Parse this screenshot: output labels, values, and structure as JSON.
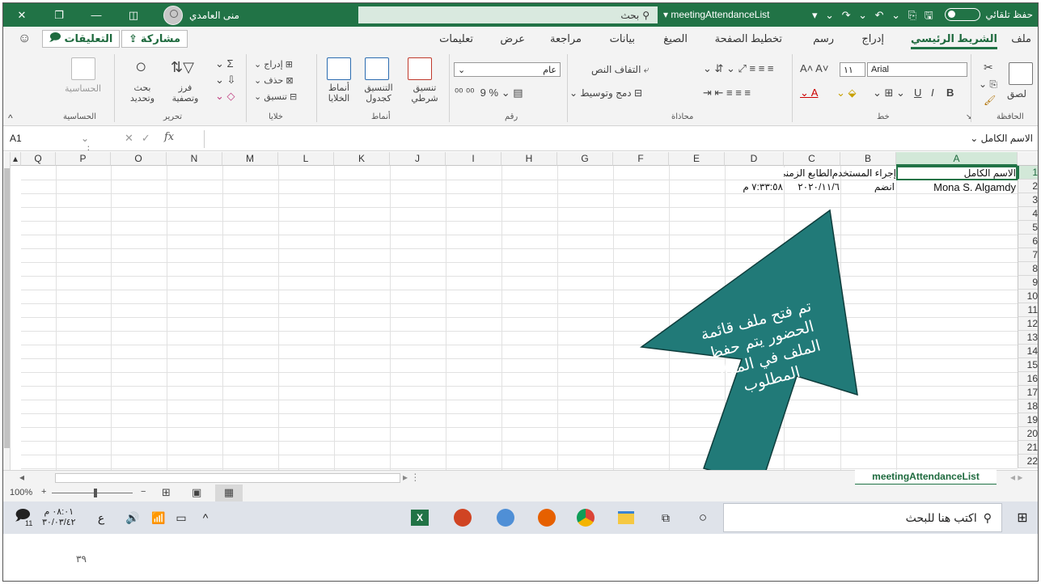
{
  "titlebar": {
    "user_name": "منى العامدي",
    "search_label": "بحث",
    "file_name": "meetingAttendanceList",
    "autosave_label": "حفظ تلقائي"
  },
  "tabs": [
    "ملف",
    "الشريط الرئيسي",
    "إدراج",
    "رسم",
    "تخطيط الصفحة",
    "الصيغ",
    "بيانات",
    "مراجعة",
    "عرض",
    "تعليمات"
  ],
  "tabs_active": "الشريط الرئيسي",
  "share_label": "مشاركة",
  "comments_label": "التعليقات",
  "ribbon": {
    "clipboard": {
      "paste": "لصق",
      "group": "الحافظة"
    },
    "font": {
      "name": "Arial",
      "size": "١١",
      "bold": "B",
      "italic": "I",
      "underline": "U",
      "group": "خط"
    },
    "alignment": {
      "wrap": "التفاف النص",
      "merge": "دمج وتوسيط",
      "group": "محاذاة"
    },
    "number": {
      "format": "عام",
      "group": "رقم"
    },
    "styles": {
      "conditional": "تنسيق شرطي",
      "as_table": "التنسيق كجدول",
      "cell_styles": "أنماط الخلايا",
      "group": "أنماط"
    },
    "cells": {
      "insert": "إدراج",
      "delete": "حذف",
      "format": "تنسيق",
      "group": "خلايا"
    },
    "editing": {
      "sort": "فرز وتصفية",
      "find": "بحث وتحديد",
      "group": "تحرير"
    },
    "sensitivity": {
      "label": "الحساسية",
      "group": "الحساسية"
    }
  },
  "formula_bar": {
    "name_box": "A1",
    "fx": "fx",
    "content": "الاسم الكامل"
  },
  "columns": [
    "A",
    "B",
    "C",
    "D",
    "E",
    "F",
    "G",
    "H",
    "I",
    "J",
    "K",
    "L",
    "M",
    "N",
    "O",
    "P",
    "Q"
  ],
  "rows": [
    "1",
    "2",
    "3",
    "4",
    "5",
    "6",
    "7",
    "8",
    "9",
    "10",
    "11",
    "12",
    "13",
    "14",
    "15",
    "16",
    "17",
    "18",
    "19",
    "20",
    "21",
    "22"
  ],
  "cells": {
    "A1": "الاسم الكامل",
    "B1": "إجراء المستخدم",
    "C1": "الطابع الزمني",
    "A2": "Mona S. Algamdy",
    "B2": "انضم",
    "C2": "٢٠٢٠/١١/٦",
    "D2": "٧:٣٣:٥٨ م"
  },
  "annotation": "تم فتح ملف قائمة الحضور يتم حفظ الملف في المكان المطلوب",
  "sheet_tab": "meetingAttendanceList",
  "zoom": "100%",
  "taskbar": {
    "search_placeholder": "اكتب هنا للبحث",
    "time": "٠٨:٠١ م",
    "date": "٣٠/٠٣/٤٢",
    "lang": "ع",
    "notif_count": "11"
  },
  "page_number": "٣٩",
  "colors": {
    "excel_green": "#217346",
    "arrow_teal": "#217a78"
  }
}
